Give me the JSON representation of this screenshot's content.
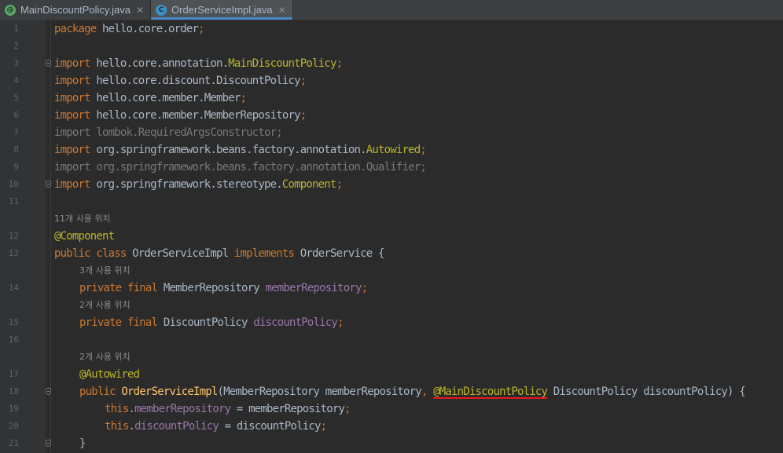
{
  "tabs": [
    {
      "label": "MainDiscountPolicy.java",
      "icon": "annotation-file-icon",
      "icon_glyph": "@",
      "active": false
    },
    {
      "label": "OrderServiceImpl.java",
      "icon": "class-file-icon",
      "icon_glyph": "C",
      "active": true
    }
  ],
  "colors": {
    "background": "#2b2b2b",
    "keyword": "#cc7832",
    "annotation": "#bbb529",
    "method": "#ffc66d",
    "field": "#9876aa",
    "plain": "#a9b7c6",
    "unused_import": "#787878",
    "error_underline": "#e8161b"
  },
  "line_numbers": [
    "1",
    "2",
    "3",
    "4",
    "5",
    "6",
    "7",
    "8",
    "9",
    "10",
    "11",
    "12",
    "13",
    "14",
    "15",
    "16",
    "17",
    "18",
    "19",
    "20",
    "21"
  ],
  "usage_hints": {
    "class": "11개 사용 위치",
    "member_repository": "3개 사용 위치",
    "discount_policy": "2개 사용 위치",
    "constructor": "2개 사용 위치"
  },
  "code": {
    "l1": [
      "package",
      " hello.core.order",
      ";"
    ],
    "l3": [
      "import",
      " hello.core.annotation.",
      "MainDiscountPolicy",
      ";"
    ],
    "l4": [
      "import",
      " hello.core.discount.DiscountPolicy",
      ";"
    ],
    "l5": [
      "import",
      " hello.core.member.Member",
      ";"
    ],
    "l6": [
      "import",
      " hello.core.member.MemberRepository",
      ";"
    ],
    "l7": "import lombok.RequiredArgsConstructor;",
    "l8": [
      "import",
      " org.springframework.beans.factory.annotation.",
      "Autowired",
      ";"
    ],
    "l9": "import org.springframework.beans.factory.annotation.Qualifier;",
    "l10": [
      "import",
      " org.springframework.stereotype.",
      "Component",
      ";"
    ],
    "l12": "@Component",
    "l13": [
      "public class",
      " OrderServiceImpl ",
      "implements",
      " OrderService {"
    ],
    "l14": [
      "private final",
      " MemberRepository ",
      "memberRepository",
      ";"
    ],
    "l15": [
      "private final",
      " DiscountPolicy ",
      "discountPolicy",
      ";"
    ],
    "l17": "@Autowired",
    "l18": [
      "public",
      " ",
      "OrderServiceImpl",
      "(MemberRepository memberRepository",
      ",",
      " ",
      "@MainDiscountPolicy",
      " DiscountPolicy discountPolicy) {"
    ],
    "l19": [
      "this",
      ".",
      "memberRepository",
      " = memberRepository",
      ";"
    ],
    "l20": [
      "this",
      ".",
      "discountPolicy",
      " = discountPolicy",
      ";"
    ],
    "l21": "}"
  }
}
